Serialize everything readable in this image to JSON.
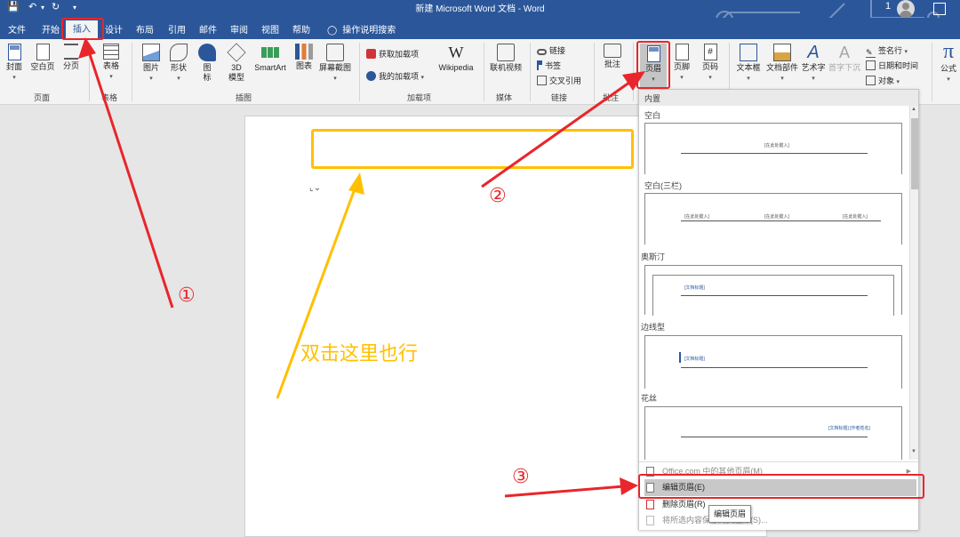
{
  "window": {
    "title": "新建 Microsoft Word 文档 - Word",
    "user_number": "1"
  },
  "tabs": [
    "文件",
    "开始",
    "插入",
    "设计",
    "布局",
    "引用",
    "邮件",
    "审阅",
    "视图",
    "帮助"
  ],
  "tell_me": "操作说明搜索",
  "ribbon": {
    "groups": {
      "pages": "页面",
      "tables": "表格",
      "illustrations": "插图",
      "addins": "加载项",
      "media": "媒体",
      "links": "链接",
      "comments": "批注"
    },
    "buttons": {
      "cover": "封面",
      "blank_page": "空白页",
      "page_break": "分页",
      "table": "表格",
      "pictures": "图片",
      "shapes": "形状",
      "icons_line1": "图",
      "icons_line2": "标",
      "model3d_line1": "3D",
      "model3d_line2": "模型",
      "smartart": "SmartArt",
      "chart": "图表",
      "screenshot": "屏幕截图",
      "get_addins": "获取加载项",
      "my_addins": "我的加载项",
      "wikipedia": "Wikipedia",
      "online_video": "联机视频",
      "link": "链接",
      "bookmark": "书签",
      "cross_ref": "交叉引用",
      "comment": "批注",
      "header": "页眉",
      "footer": "页脚",
      "page_number": "页码",
      "text_box": "文本框",
      "quick_parts": "文档部件",
      "wordart": "艺术字",
      "drop_cap": "首字下沉",
      "signature": "签名行",
      "date_time": "日期和时间",
      "object": "对象",
      "equation": "公式"
    }
  },
  "gallery": {
    "heading": "内置",
    "items": [
      {
        "name": "空白",
        "placeholder": "[在此处键入]"
      },
      {
        "name": "空白(三栏)",
        "placeholder": "[在此处键入]"
      },
      {
        "name": "奥斯汀",
        "placeholder": "[文档标题]"
      },
      {
        "name": "边线型",
        "placeholder": "[文档标题]"
      },
      {
        "name": "花丝",
        "placeholder": "[文档标题] [作者姓名]"
      }
    ],
    "menu": {
      "more_from_office": "Office.com 中的其他页眉(M)",
      "edit_header": "编辑页眉(E)",
      "remove_header": "删除页眉(R)",
      "save_selection": "将所选内容保存到页眉库(S)..."
    },
    "tooltip": "编辑页眉"
  },
  "annotations": {
    "note": "双击这里也行",
    "step1": "①",
    "step2": "②",
    "step3": "③"
  },
  "colors": {
    "brand_blue": "#2b579a",
    "annotation_red": "#e8262b",
    "annotation_orange": "#ffc000"
  }
}
